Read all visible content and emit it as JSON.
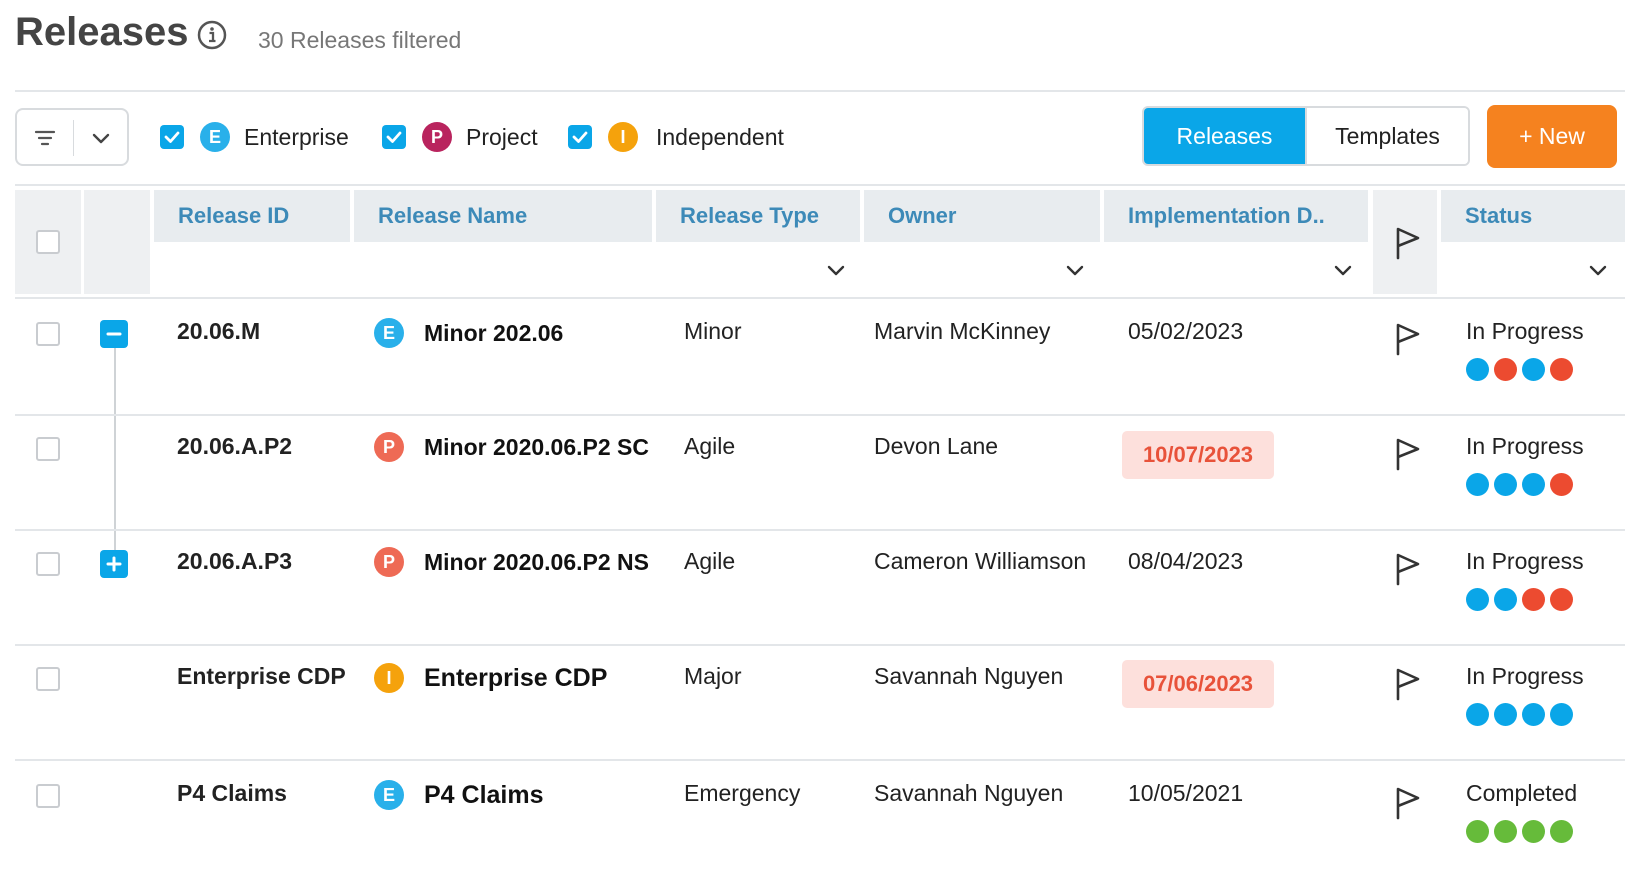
{
  "header": {
    "title": "Releases",
    "info_icon": "info-circle-icon",
    "subtitle": "30 Releases filtered"
  },
  "toolbar": {
    "filter_icon": "filter-lines-icon",
    "dropdown_icon": "chevron-down-icon",
    "type_filters": [
      {
        "badge": "E",
        "label": "Enterprise",
        "checked": true,
        "color": "#29b0ea"
      },
      {
        "badge": "P",
        "label": "Project",
        "checked": true,
        "color": "#b9245e"
      },
      {
        "badge": "I",
        "label": "Independent",
        "checked": true,
        "color": "#f5a20c"
      }
    ],
    "view_toggle": {
      "releases": "Releases",
      "templates": "Templates",
      "active": "Releases"
    },
    "new_label": "+ New"
  },
  "table": {
    "columns": [
      "Release ID",
      "Release Name",
      "Release Type",
      "Owner",
      "Implementation D..",
      "Status"
    ],
    "rows": [
      {
        "id": "20.06.M",
        "type_badge": "E",
        "badge_color": "#29b0ea",
        "name": "Minor 202.06",
        "release_type": "Minor",
        "owner": "Marvin McKinney",
        "date": "05/02/2023",
        "date_overdue": false,
        "status": "In Progress",
        "dots": [
          "#0aa6e8",
          "#ec4b30",
          "#0aa6e8",
          "#ec4b30"
        ]
      },
      {
        "id": "20.06.A.P2",
        "type_badge": "P",
        "badge_color": "#ee6a55",
        "name": "Minor 2020.06.P2 SC",
        "release_type": "Agile",
        "owner": "Devon Lane",
        "date": "10/07/2023",
        "date_overdue": true,
        "status": "In Progress",
        "dots": [
          "#0aa6e8",
          "#0aa6e8",
          "#0aa6e8",
          "#ec4b30"
        ]
      },
      {
        "id": "20.06.A.P3",
        "type_badge": "P",
        "badge_color": "#ee6a55",
        "name": "Minor 2020.06.P2 NS",
        "release_type": "Agile",
        "owner": "Cameron Williamson",
        "date": "08/04/2023",
        "date_overdue": false,
        "status": "In Progress",
        "dots": [
          "#0aa6e8",
          "#0aa6e8",
          "#ec4b30",
          "#ec4b30"
        ]
      },
      {
        "id": "Enterprise CDP",
        "type_badge": "I",
        "badge_color": "#f5a20c",
        "name": "Enterprise CDP",
        "release_type": "Major",
        "owner": "Savannah Nguyen",
        "date": "07/06/2023",
        "date_overdue": true,
        "status": "In Progress",
        "dots": [
          "#0aa6e8",
          "#0aa6e8",
          "#0aa6e8",
          "#0aa6e8"
        ]
      },
      {
        "id": "P4 Claims",
        "type_badge": "E",
        "badge_color": "#29b0ea",
        "name": "P4 Claims",
        "release_type": "Emergency",
        "owner": "Savannah Nguyen",
        "date": "10/05/2021",
        "date_overdue": false,
        "status": "Completed",
        "dots": [
          "#66bb3a",
          "#66bb3a",
          "#66bb3a",
          "#66bb3a"
        ]
      }
    ]
  },
  "colors": {
    "accent": "#0aa6e8",
    "new_button": "#f5821f",
    "header_text": "#3d8ab8",
    "overdue_bg": "#fde0dc",
    "overdue_text": "#e8523a"
  }
}
